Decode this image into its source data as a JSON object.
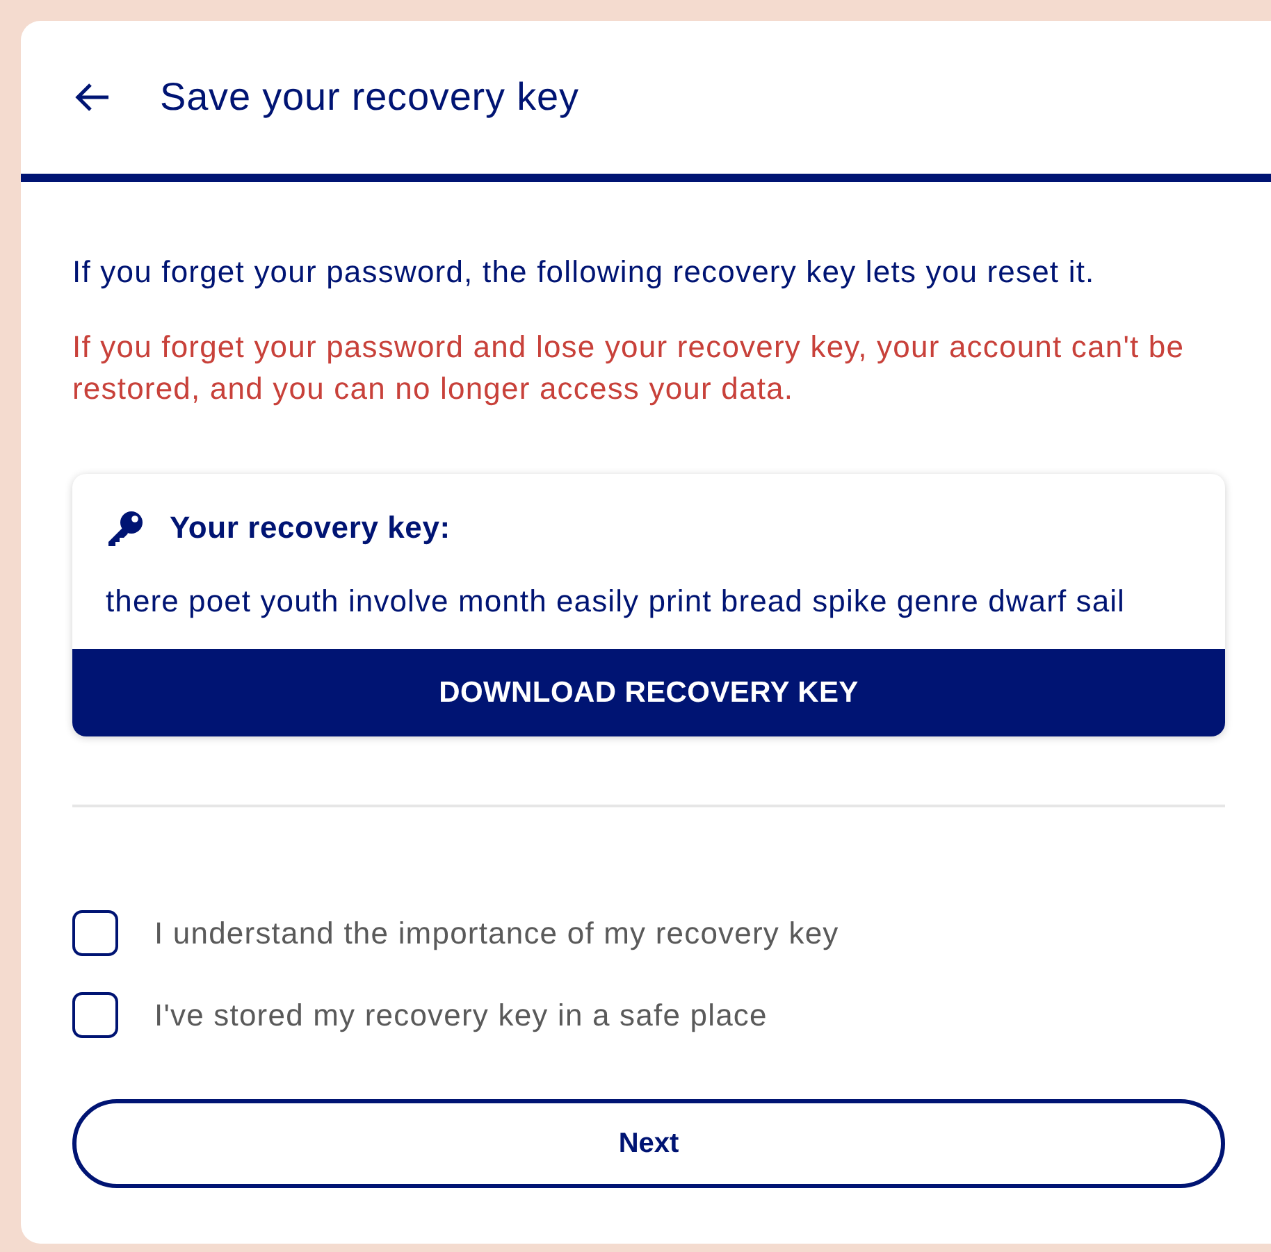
{
  "header": {
    "title": "Save your recovery key"
  },
  "intro": "If you forget your password, the following recovery key lets you reset it.",
  "warning": "If you forget your password and lose your recovery key, your account can't be restored, and you can no longer access your data.",
  "key_card": {
    "label": "Your recovery key:",
    "key": "there poet youth involve month easily print bread spike genre dwarf sail",
    "button": "DOWNLOAD RECOVERY KEY"
  },
  "checkboxes": [
    {
      "label": "I understand the importance of my recovery key",
      "checked": false
    },
    {
      "label": "I've stored my recovery key in a safe place",
      "checked": false
    }
  ],
  "next_button": "Next"
}
